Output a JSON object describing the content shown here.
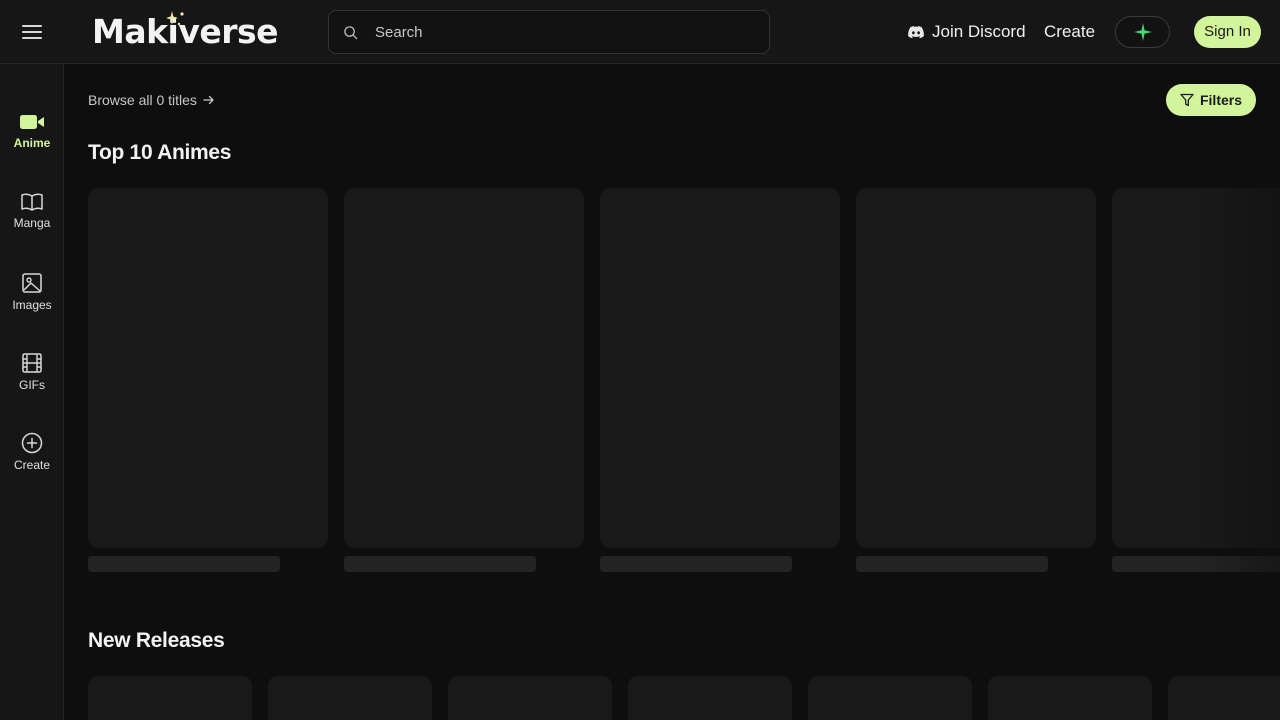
{
  "header": {
    "logo_text": "Makiverse",
    "search_placeholder": "Search",
    "discord_label": "Join Discord",
    "create_label": "Create",
    "signin_label": "Sign In",
    "accent_color": "#d2f59b"
  },
  "sidebar": {
    "items": [
      {
        "label": "Anime",
        "icon": "video-camera-icon",
        "active": true
      },
      {
        "label": "Manga",
        "icon": "book-open-icon",
        "active": false
      },
      {
        "label": "Images",
        "icon": "image-icon",
        "active": false
      },
      {
        "label": "GIFs",
        "icon": "film-icon",
        "active": false
      },
      {
        "label": "Create",
        "icon": "plus-circle-icon",
        "active": false
      }
    ]
  },
  "main": {
    "browse_label": "Browse all 0 titles",
    "filters_label": "Filters",
    "sections": [
      {
        "title": "Top 10 Animes"
      },
      {
        "title": "New Releases"
      }
    ]
  }
}
